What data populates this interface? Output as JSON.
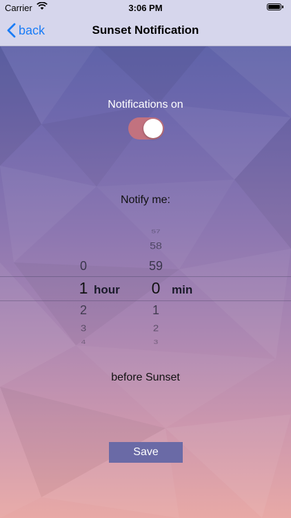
{
  "status_bar": {
    "carrier": "Carrier",
    "time": "3:06 PM"
  },
  "nav": {
    "back_label": "back",
    "title": "Sunset Notification"
  },
  "notifications": {
    "label": "Notifications on",
    "enabled": true
  },
  "notify_label": "Notify me:",
  "picker": {
    "hours": {
      "values": [
        "0",
        "1",
        "2",
        "3",
        "4"
      ],
      "selected": "1",
      "unit": "hour"
    },
    "minutes": {
      "values": [
        "57",
        "58",
        "59",
        "0",
        "1",
        "2",
        "3"
      ],
      "selected": "0",
      "unit": "min"
    }
  },
  "before_label": "before Sunset",
  "save_label": "Save",
  "colors": {
    "accent": "#1a7cf6",
    "toggle_on": "#c2727f",
    "save_button": "#6a6aa6",
    "nav_bg": "#d6d6ec"
  }
}
